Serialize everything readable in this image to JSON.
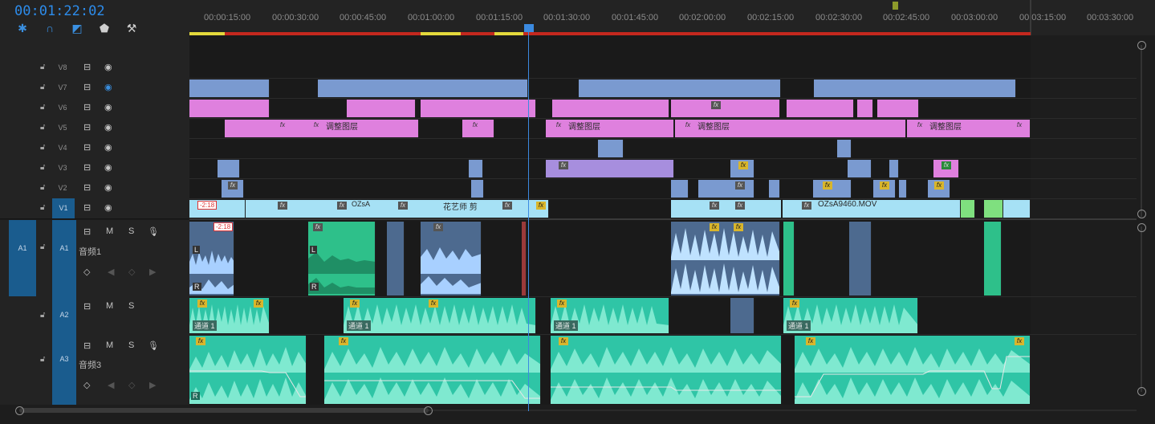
{
  "timecode": "00:01:22:02",
  "ruler": {
    "ticks": [
      "00:00:15:00",
      "00:00:30:00",
      "00:00:45:00",
      "00:01:00:00",
      "00:01:15:00",
      "00:01:30:00",
      "00:01:45:00",
      "00:02:00:00",
      "00:02:15:00",
      "00:02:30:00",
      "00:02:45:00",
      "00:03:00:00",
      "00:03:15:00",
      "00:03:30:00"
    ]
  },
  "tools": [
    "snap-icon",
    "magnet-icon",
    "linked-selection-icon",
    "marker-icon",
    "wrench-icon"
  ],
  "video_tracks": [
    "V8",
    "V7",
    "V6",
    "V5",
    "V4",
    "V3",
    "V2",
    "V1"
  ],
  "audio_tracks": [
    {
      "id": "A1",
      "name": "音频1",
      "source": "A1"
    },
    {
      "id": "A2",
      "name": "",
      "source": ""
    },
    {
      "id": "A3",
      "name": "音频3",
      "source": ""
    }
  ],
  "audio_row_labels": {
    "mute": "M",
    "solo": "S"
  },
  "clip_labels": {
    "adjust": "调整图层",
    "ozsa": "OZsA",
    "huayi": "花艺师 剪",
    "mov": "OZsA9460.MOV",
    "speed_badge": "-2:18",
    "channel": "通道 1",
    "fx": "fx",
    "left": "L",
    "right": "R"
  },
  "colors": {
    "accent": "#2d8ceb",
    "range": "#c4281e",
    "pink": "#df80de",
    "blue": "#7a9ad0",
    "teal": "#2fc5a6"
  }
}
